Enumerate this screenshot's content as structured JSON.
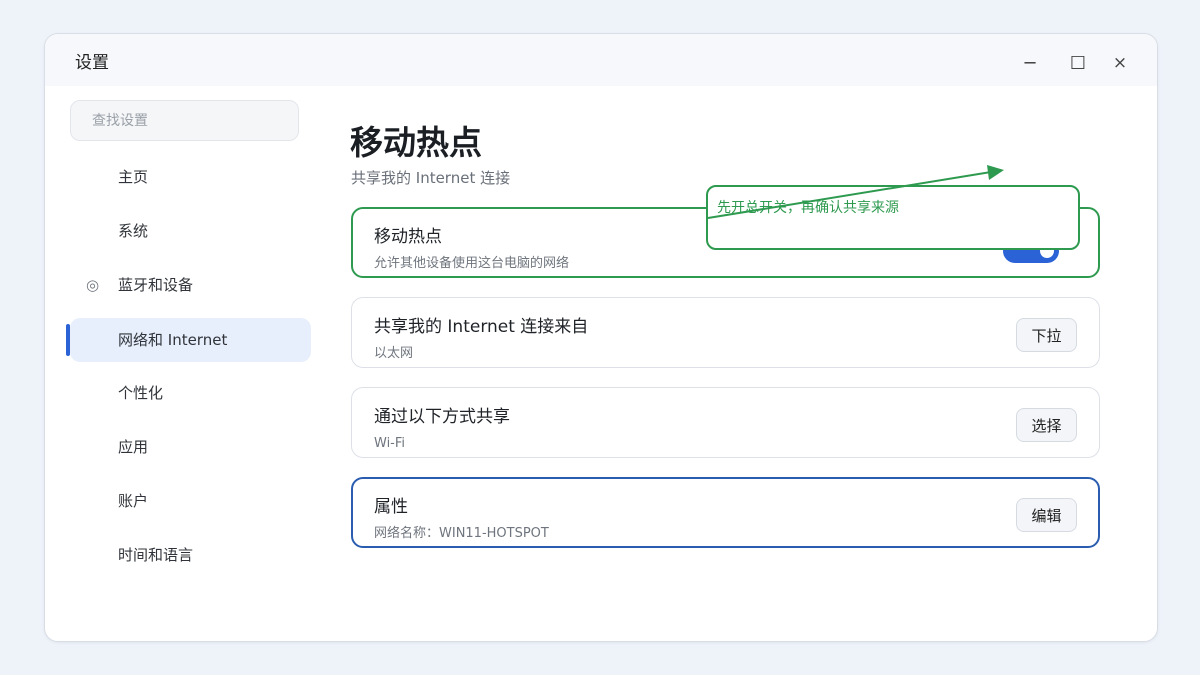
{
  "window": {
    "title": "设置",
    "controls": {
      "minimize": "─",
      "maximize": "☐",
      "close": "×"
    }
  },
  "sidebar": {
    "search_placeholder": "查找设置",
    "items": [
      {
        "label": "主页",
        "icon": ""
      },
      {
        "label": "系统",
        "icon": ""
      },
      {
        "label": "蓝牙和设备",
        "icon": "◎"
      },
      {
        "label": "网络和 Internet",
        "icon": "",
        "active": true
      },
      {
        "label": "个性化",
        "icon": ""
      },
      {
        "label": "应用",
        "icon": ""
      },
      {
        "label": "账户",
        "icon": ""
      },
      {
        "label": "时间和语言",
        "icon": ""
      }
    ]
  },
  "main": {
    "title": "移动热点",
    "subtitle": "共享我的 Internet 连接",
    "cards": [
      {
        "title": "移动热点",
        "desc": "允许其他设备使用这台电脑的网络",
        "control": "toggle",
        "toggle_on": true
      },
      {
        "title": "共享我的 Internet 连接来自",
        "desc": "以太网",
        "button": "下拉"
      },
      {
        "title": "通过以下方式共享",
        "desc": "Wi-Fi",
        "button": "选择"
      },
      {
        "title": "属性",
        "desc": "网络名称：WIN11-HOTSPOT",
        "button": "编辑"
      }
    ]
  },
  "annotation": {
    "text": "先开总开关，再确认共享来源",
    "color": "#2e9a4f"
  },
  "colors": {
    "accent": "#2b63d7",
    "highlight_green": "#2e9a4f",
    "highlight_blue": "#2a5db0"
  }
}
